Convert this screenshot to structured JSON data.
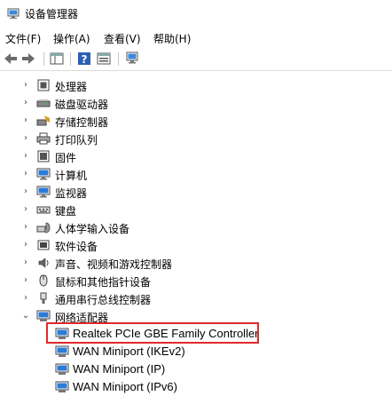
{
  "window": {
    "title": "设备管理器"
  },
  "menu": [
    "文件(F)",
    "操作(A)",
    "查看(V)",
    "帮助(H)"
  ],
  "toolbar": {
    "buttons": [
      "back-icon",
      "forward-icon",
      "show-hide-tree-icon",
      "help-icon",
      "properties-icon",
      "scan-hardware-icon"
    ]
  },
  "tree": {
    "categories": [
      {
        "label": "处理器",
        "icon": "processor-icon",
        "expanded": false
      },
      {
        "label": "磁盘驱动器",
        "icon": "disk-drive-icon",
        "expanded": false
      },
      {
        "label": "存储控制器",
        "icon": "storage-controller-icon",
        "expanded": false
      },
      {
        "label": "打印队列",
        "icon": "print-queue-icon",
        "expanded": false
      },
      {
        "label": "固件",
        "icon": "firmware-icon",
        "expanded": false
      },
      {
        "label": "计算机",
        "icon": "computer-icon",
        "expanded": false
      },
      {
        "label": "监视器",
        "icon": "monitor-icon",
        "expanded": false
      },
      {
        "label": "键盘",
        "icon": "keyboard-icon",
        "expanded": false
      },
      {
        "label": "人体学输入设备",
        "icon": "hid-icon",
        "expanded": false
      },
      {
        "label": "软件设备",
        "icon": "software-device-icon",
        "expanded": false
      },
      {
        "label": "声音、视频和游戏控制器",
        "icon": "audio-icon",
        "expanded": false
      },
      {
        "label": "鼠标和其他指针设备",
        "icon": "mouse-icon",
        "expanded": false
      },
      {
        "label": "通用串行总线控制器",
        "icon": "usb-icon",
        "expanded": false
      },
      {
        "label": "网络适配器",
        "icon": "network-adapter-icon",
        "expanded": true
      }
    ],
    "network_adapters": [
      "Realtek PCIe GBE Family Controller",
      "WAN Miniport (IKEv2)",
      "WAN Miniport (IP)",
      "WAN Miniport (IPv6)"
    ],
    "highlighted_item": "Realtek PCIe GBE Family Controller"
  },
  "colors": {
    "highlight": "#e02a2a",
    "icon_blue": "#2b7bd6"
  }
}
